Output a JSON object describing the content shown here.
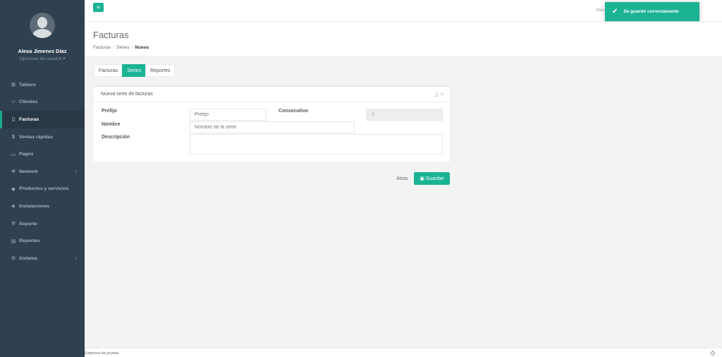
{
  "profile": {
    "name": "Alexa Jimenez Díaz",
    "options": "Opciones de usuario ▾"
  },
  "nav": [
    {
      "label": "Tablero",
      "icon": "dashboard-icon",
      "glyph": "⊞"
    },
    {
      "label": "Clientes",
      "icon": "users-icon",
      "glyph": "☺"
    },
    {
      "label": "Facturas",
      "icon": "file-icon",
      "glyph": "▯"
    },
    {
      "label": "Ventas rápidas",
      "icon": "dollar-icon",
      "glyph": "$"
    },
    {
      "label": "Pagos",
      "icon": "money-icon",
      "glyph": "▭"
    },
    {
      "label": "Network",
      "icon": "network-icon",
      "glyph": "✻",
      "arrow": "‹"
    },
    {
      "label": "Productos y servicios",
      "icon": "tag-icon",
      "glyph": "◆"
    },
    {
      "label": "Instalaciones",
      "icon": "wrench-icon",
      "glyph": "◈"
    },
    {
      "label": "Soporte",
      "icon": "tool-icon",
      "glyph": "⚒"
    },
    {
      "label": "Reportes",
      "icon": "chart-icon",
      "glyph": "▤"
    },
    {
      "label": "Sistema",
      "icon": "cogs-icon",
      "glyph": "⚙",
      "arrow": "‹"
    }
  ],
  "topbar": {
    "welcome": "Bien",
    "toast": "Se guardó correctamente"
  },
  "page": {
    "title": "Facturas",
    "breadcrumb": [
      "Facturas",
      "Series",
      "Nueva"
    ]
  },
  "tabs": [
    "Facturas",
    "Series",
    "Reportes"
  ],
  "panel": {
    "title": "Nueva serie de facturas",
    "tools": "⎙ ✕",
    "prefijo_label": "Prefijo",
    "prefijo_placeholder": "Prefijo",
    "consecutivo_label": "Consecutivo",
    "consecutivo_value": "1",
    "nombre_label": "Nombre",
    "nombre_placeholder": "Nombre de la serie",
    "descripcion_label": "Descripción"
  },
  "actions": {
    "back": "Atras",
    "save": "Guardar"
  },
  "footer": {
    "company": "Empresa de prueba"
  },
  "colors": {
    "sidebar": "#2f4050",
    "accent": "#1ab394"
  }
}
